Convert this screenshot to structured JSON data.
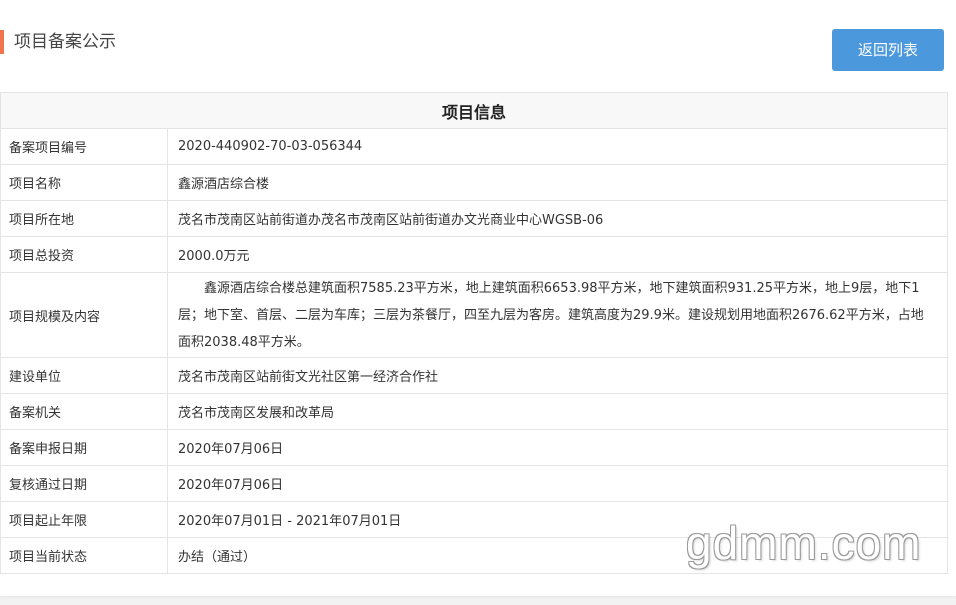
{
  "header": {
    "title": "项目备案公示",
    "back_button_label": "返回列表"
  },
  "table": {
    "title": "项目信息",
    "rows": [
      {
        "label": "备案项目编号",
        "value": "2020-440902-70-03-056344"
      },
      {
        "label": "项目名称",
        "value": "鑫源酒店综合楼"
      },
      {
        "label": "项目所在地",
        "value": "茂名市茂南区站前街道办茂名市茂南区站前街道办文光商业中心WGSB-06"
      },
      {
        "label": "项目总投资",
        "value": "2000.0万元"
      },
      {
        "label": "项目规模及内容",
        "value": "鑫源酒店综合楼总建筑面积7585.23平方米，地上建筑面积6653.98平方米，地下建筑面积931.25平方米，地上9层，地下1层；地下室、首层、二层为车库；三层为茶餐厅，四至九层为客房。建筑高度为29.9米。建设规划用地面积2676.62平方米，占地面积2038.48平方米。"
      },
      {
        "label": "建设单位",
        "value": "茂名市茂南区站前街文光社区第一经济合作社"
      },
      {
        "label": "备案机关",
        "value": "茂名市茂南区发展和改革局"
      },
      {
        "label": "备案申报日期",
        "value": "2020年07月06日"
      },
      {
        "label": "复核通过日期",
        "value": "2020年07月06日"
      },
      {
        "label": "项目起止年限",
        "value": "2020年07月01日 - 2021年07月01日"
      },
      {
        "label": "项目当前状态",
        "value": "办结（通过）"
      }
    ]
  },
  "watermark": "gdmm.com",
  "colors": {
    "accent_bar": "#f0744c",
    "button_bg": "#4b98dc",
    "border": "#e4e4e4"
  }
}
